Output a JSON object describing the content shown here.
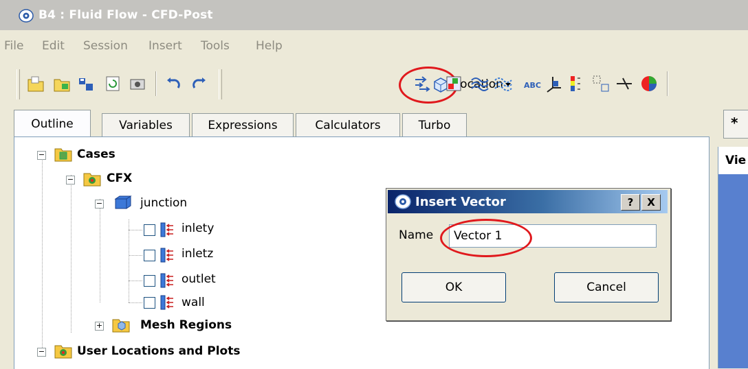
{
  "window": {
    "title": "B4 : Fluid Flow - CFD-Post"
  },
  "menu": [
    "File",
    "Edit",
    "Session",
    "Insert",
    "Tools",
    "Help"
  ],
  "toolbar": {
    "icons": [
      "open-icon",
      "load-icon",
      "save-icon",
      "refresh-icon",
      "screenshot-icon",
      "undo-icon",
      "redo-icon",
      "vector-icon",
      "contour-icon",
      "streamline-icon",
      "particle-track-icon",
      "text-icon",
      "coordinate-frame-icon",
      "legend-icon",
      "instance-transform-icon",
      "clip-plane-icon",
      "color-map-icon"
    ],
    "location_label": "Location"
  },
  "tabs": [
    "Outline",
    "Variables",
    "Expressions",
    "Calculators",
    "Turbo"
  ],
  "tree": {
    "cases": "Cases",
    "cfx": "CFX",
    "domain": "junction",
    "boundaries": [
      "inlety",
      "inletz",
      "outlet",
      "wall"
    ],
    "mesh_regions": "Mesh Regions",
    "user_locations": "User Locations and Plots"
  },
  "viewer": {
    "tab_label": "*",
    "header_label": "Vie"
  },
  "dialog": {
    "title": "Insert Vector",
    "help_label": "?",
    "close_label": "X",
    "name_label": "Name",
    "name_value": "Vector 1",
    "ok_label": "OK",
    "cancel_label": "Cancel"
  },
  "colors": {
    "highlight": "#e0191d",
    "dialog_title": "#0a246a",
    "viewport": "#5880cf"
  }
}
